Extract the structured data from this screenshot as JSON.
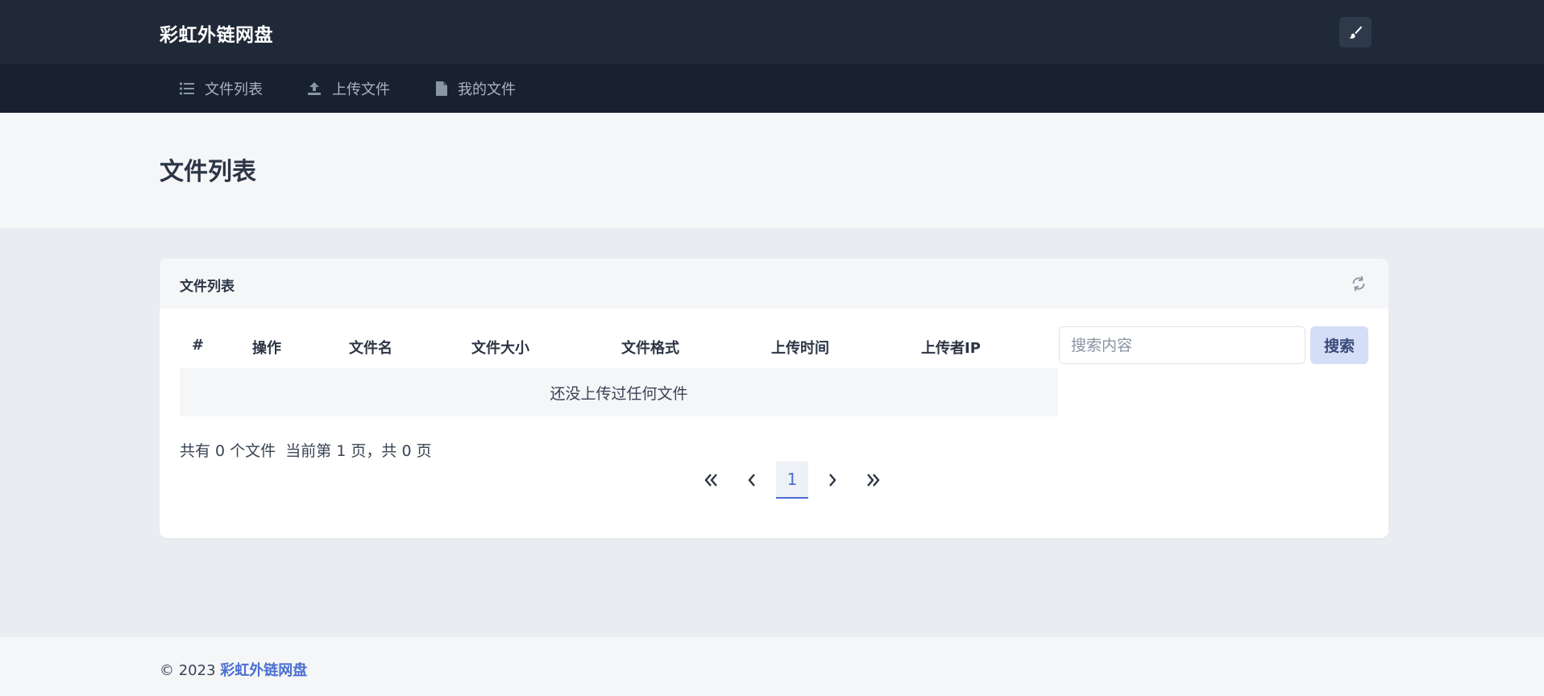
{
  "header": {
    "brand": "彩虹外链网盘",
    "theme_button_icon": "paintbrush-icon"
  },
  "nav": {
    "items": [
      {
        "label": "文件列表",
        "icon": "list-icon"
      },
      {
        "label": "上传文件",
        "icon": "upload-icon"
      },
      {
        "label": "我的文件",
        "icon": "file-icon"
      }
    ]
  },
  "page": {
    "title": "文件列表"
  },
  "card": {
    "title": "文件列表",
    "refresh_icon": "refresh-icon",
    "table": {
      "columns": [
        "#",
        "操作",
        "文件名",
        "文件大小",
        "文件格式",
        "上传时间",
        "上传者IP"
      ],
      "empty_text": "还没上传过任何文件"
    },
    "search": {
      "placeholder": "搜索内容",
      "value": "",
      "button_label": "搜索"
    },
    "summary": "共有 0 个文件  当前第 1 页，共 0 页",
    "pagination": {
      "first": "«",
      "prev": "‹",
      "current": "1",
      "next": "›",
      "last": "»"
    }
  },
  "footer": {
    "copyright": "© 2023",
    "site_name": "彩虹外链网盘"
  },
  "colors": {
    "topbar": "#1f2937",
    "navbar": "#18212e",
    "accent": "#4a6fd1",
    "search_button_bg": "#d4def6"
  }
}
